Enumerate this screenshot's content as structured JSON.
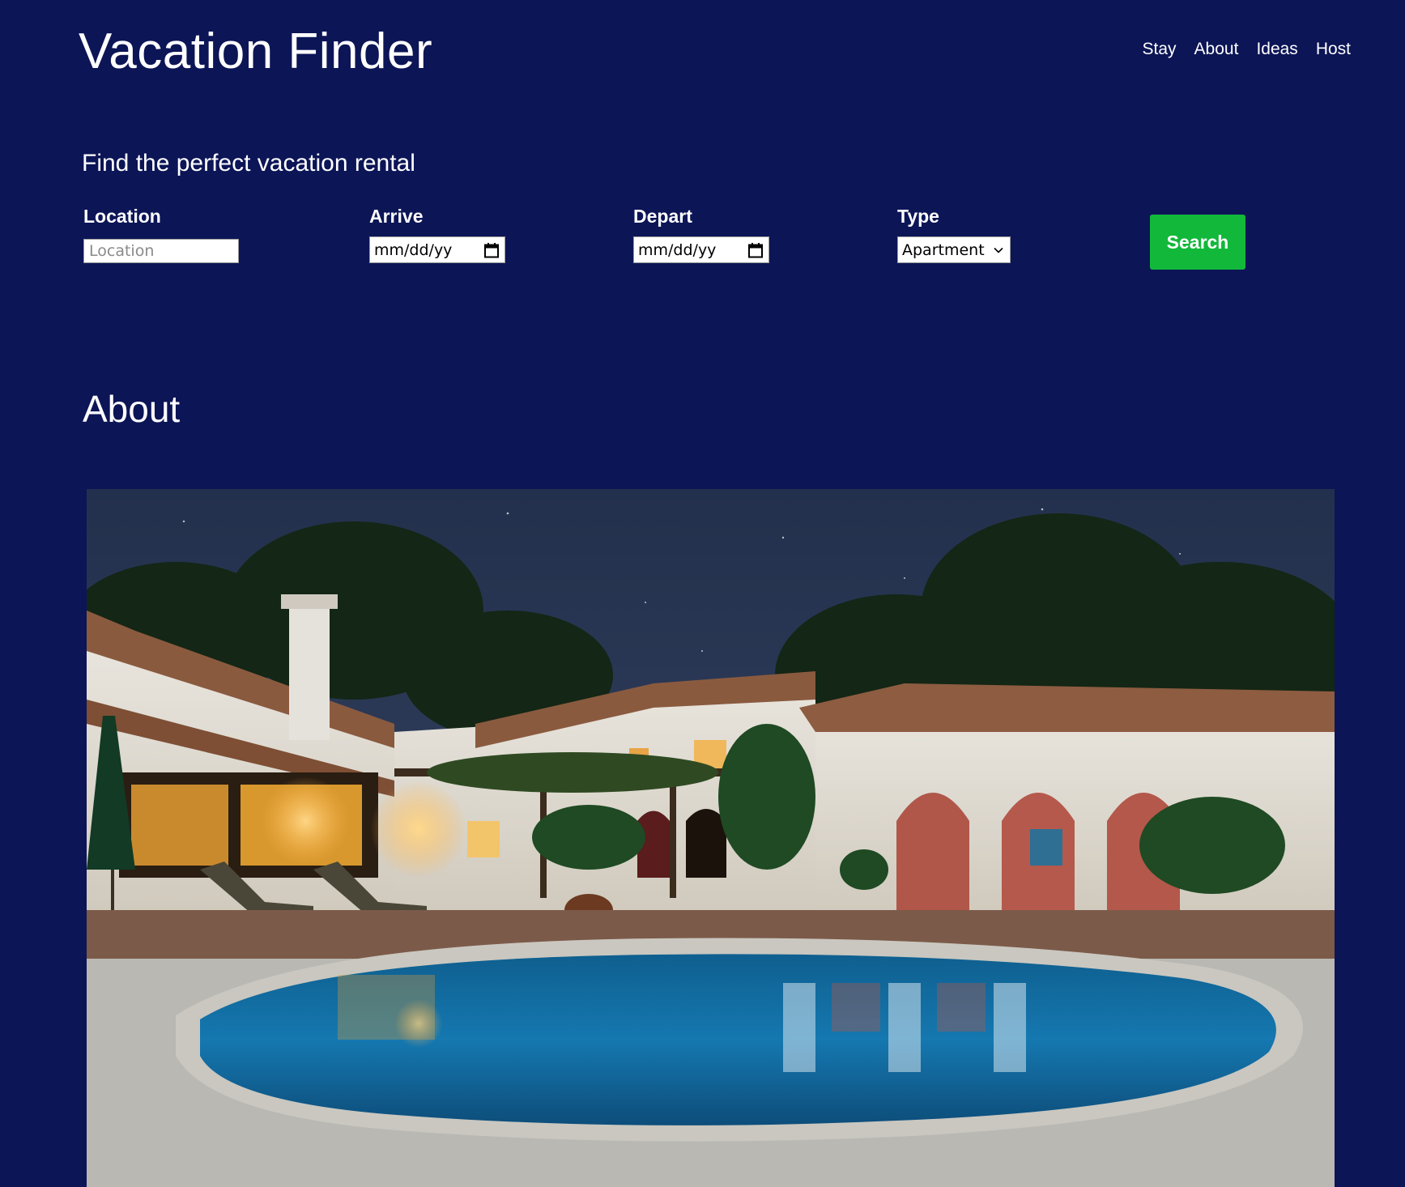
{
  "header": {
    "title": "Vacation Finder",
    "nav": [
      "Stay",
      "About",
      "Ideas",
      "Host"
    ]
  },
  "search": {
    "heading": "Find the perfect vacation rental",
    "location": {
      "label": "Location",
      "placeholder": "Location",
      "value": ""
    },
    "arrive": {
      "label": "Arrive",
      "value": "mm/dd/yy"
    },
    "depart": {
      "label": "Depart",
      "value": "mm/dd/yy"
    },
    "type": {
      "label": "Type",
      "value": "Apartment"
    },
    "button_label": "Search"
  },
  "about": {
    "heading": "About",
    "image": "villa-with-pool-at-night"
  },
  "colors": {
    "background": "#0c1556",
    "accent": "#12b83a",
    "text": "#ffffff"
  },
  "icons": [
    "calendar-icon",
    "chevron-down-icon"
  ]
}
